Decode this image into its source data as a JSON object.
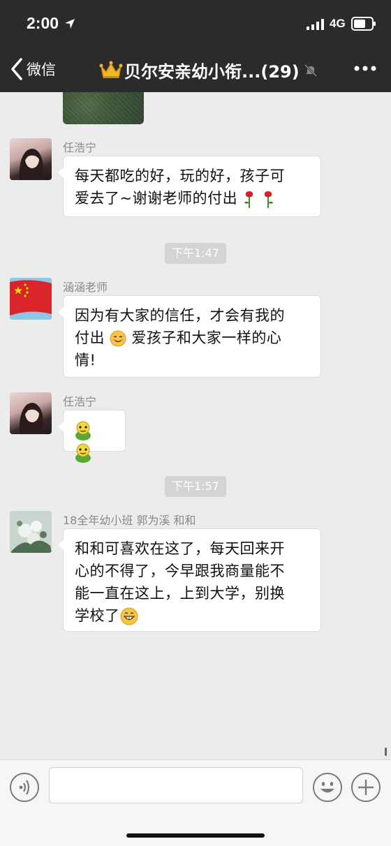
{
  "status_bar": {
    "time": "2:00",
    "network": "4G"
  },
  "nav": {
    "back_label": "微信",
    "title": "贝尔安亲幼小衔...(29)"
  },
  "messages": [
    {
      "sender": "任浩宁",
      "text": "每天都吃的好，玩的好，孩子可\n爱去了~谢谢老师的付出"
    },
    {
      "type": "time",
      "time": "下午1:47"
    },
    {
      "sender": "涵涵老师",
      "line1": "因为有大家的信任，才会有我的",
      "line2_a": "付出",
      "line2_b": "爱孩子和大家一样的心",
      "line3": "情!"
    },
    {
      "sender": "任浩宁",
      "text": ""
    },
    {
      "type": "time",
      "time": "下午1:57"
    },
    {
      "sender": "18全年幼小班  郭为溪  和和",
      "text": "和和可喜欢在这了，每天回来开\n心的不得了，今早跟我商量能不\n能一直在这上，上到大学，别换\n学校了"
    }
  ],
  "colors": {
    "header_bg": "#2b2b2d",
    "chat_bg": "#ececec",
    "bubble_bg": "#ffffff",
    "time_pill_bg": "#d4d4d4"
  },
  "icons": {
    "location": "location-arrow-icon",
    "signal": "signal-bars-icon",
    "battery": "battery-icon",
    "back": "chevron-left-icon",
    "crown": "crown-icon",
    "mute": "mute-bell-icon",
    "more": "more-dots-icon",
    "voice": "voice-icon",
    "emoji": "emoji-face-icon",
    "plus": "plus-icon"
  }
}
